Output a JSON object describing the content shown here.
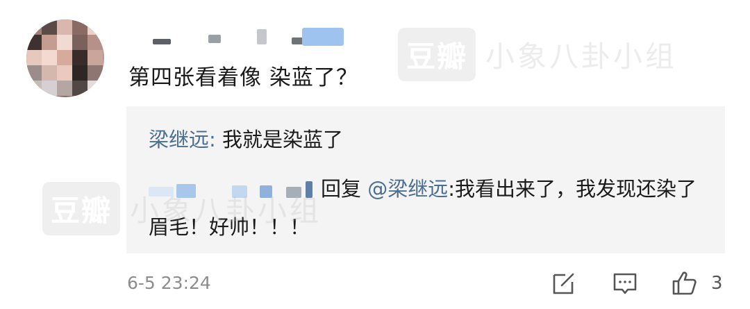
{
  "comment": {
    "text": "第四张看着像 染蓝了？",
    "timestamp": "6-5 23:24",
    "like_count": "3"
  },
  "reply": {
    "author": "梁继远",
    "colon": ":",
    "text": " 我就是染蓝了",
    "sub_reply": {
      "label": "回复",
      "mention": "@梁继远",
      "text": ":我看出来了，我发现还染了眉毛！好帅！！！"
    }
  },
  "watermark": {
    "logo": "豆瓣",
    "text": "小象八卦小组"
  },
  "icons": {
    "edit": "edit-icon",
    "comment": "comment-icon",
    "like": "thumbs-up-icon"
  },
  "colors": {
    "link": "#4a6e93",
    "reply_bg": "#f4f4f4",
    "meta": "#8c8c8c"
  }
}
